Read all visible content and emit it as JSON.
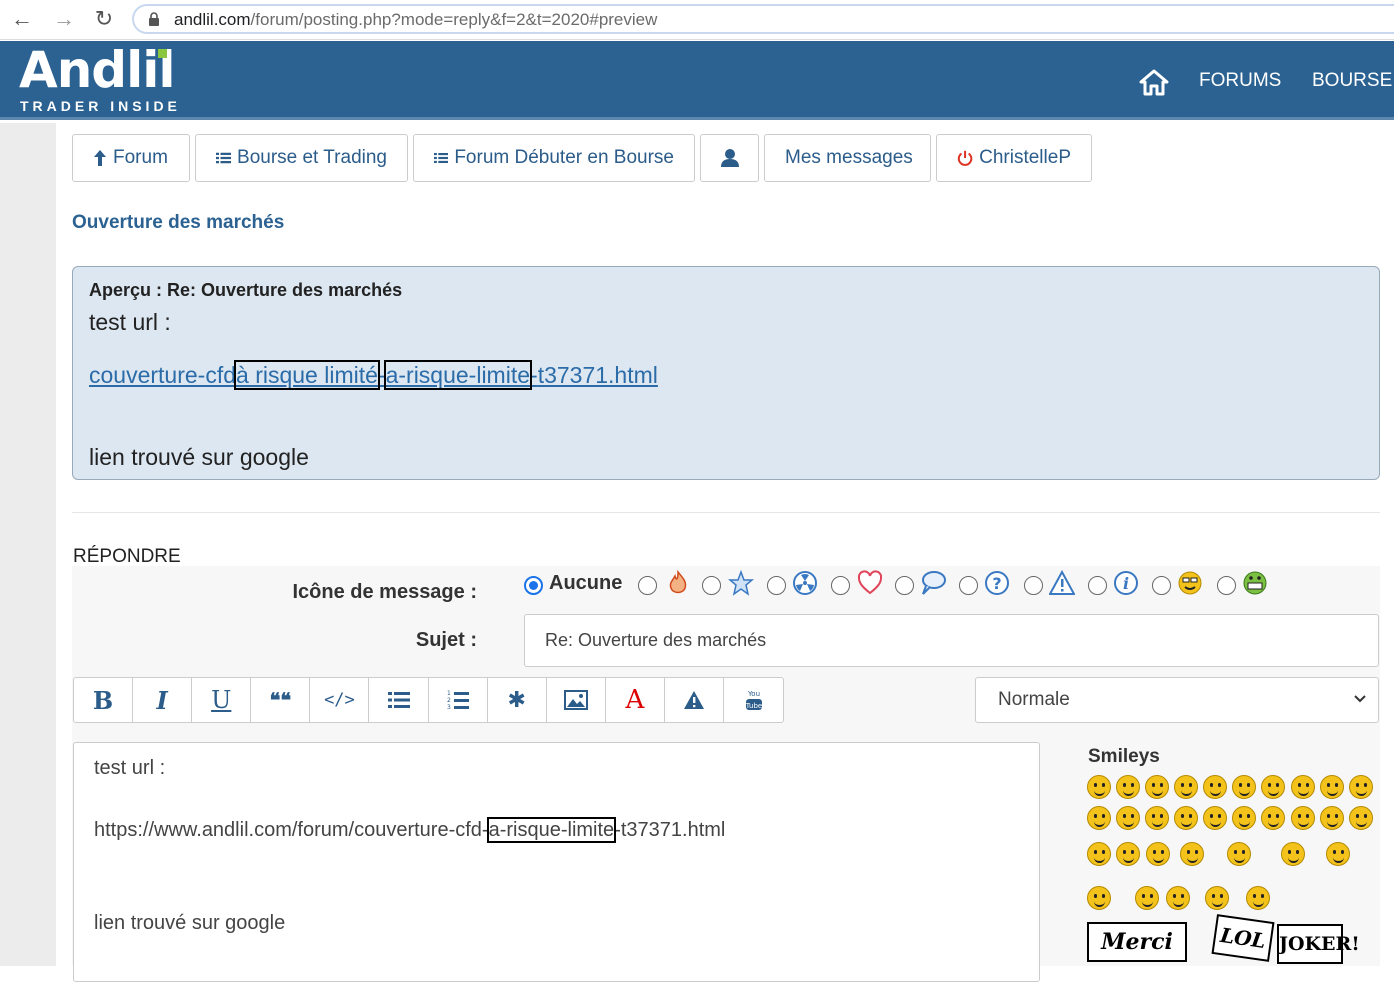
{
  "browser": {
    "url_host": "andlil.com",
    "url_path": "/forum/posting.php?mode=reply&f=2&t=2020#preview",
    "back_icon": "←",
    "forward_icon": "→",
    "reload_icon": "↻"
  },
  "header": {
    "logo": "Andlil",
    "logo_tagline": "TRADER INSIDE",
    "links": [
      "FORUMS",
      "BOURSE"
    ]
  },
  "nav": {
    "forum": "Forum",
    "bourse": "Bourse et Trading",
    "debuter": "Forum Débuter en Bourse",
    "messages": "Mes messages",
    "user": "ChristelleP"
  },
  "topic_title": "Ouverture des marchés",
  "preview": {
    "heading": "Aperçu : Re: Ouverture des marchés",
    "line1": "test url :",
    "link_part1": "couverture-cfd",
    "link_part2": "à risque limité",
    "link_part3": "a-risque-limite",
    "link_part4": "t37371.html",
    "line3": "lien trouvé sur google"
  },
  "reply": {
    "title": "RÉPONDRE",
    "icon_label": "Icône de message :",
    "icon_none": "Aucune",
    "subject_label": "Sujet :",
    "subject_value": "Re: Ouverture des marchés",
    "font_size": "Normale"
  },
  "toolbar": {
    "bold": "B",
    "italic": "I",
    "underline": "U",
    "quote": "❝❝",
    "code": "</>",
    "list": "☰",
    "list_num": "☷",
    "star": "✱",
    "image": "▣",
    "color": "A",
    "warn": "▲",
    "youtube": "▶"
  },
  "editor": {
    "line1": "test url :",
    "line2_a": "https://www.andlil.com/forum/couverture-cfd-",
    "line2_b": "a-risque-limite",
    "line2_c": "-t37371.html",
    "line3": "lien trouvé sur google"
  },
  "smileys": {
    "title": "Smileys",
    "merci": "Merci",
    "lol": "LOL",
    "joker": "JOKER!"
  },
  "colors": {
    "header_bg": "#2b6292",
    "link": "#2b6ca8",
    "preview_bg": "#dce7f1"
  }
}
